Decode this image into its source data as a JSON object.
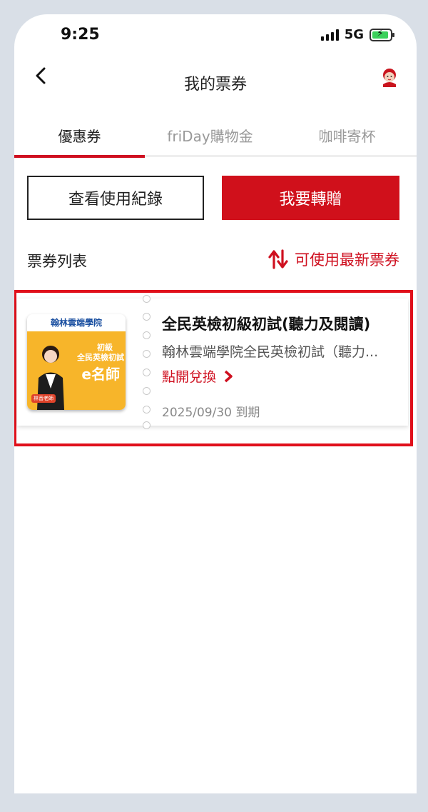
{
  "status_bar": {
    "time": "9:25",
    "network": "5G"
  },
  "header": {
    "title": "我的票券",
    "back_icon": "chevron-left-icon",
    "avatar_icon": "support-agent-icon"
  },
  "tabs": [
    {
      "label": "優惠券",
      "active": true
    },
    {
      "label": "friDay購物金",
      "active": false
    },
    {
      "label": "咖啡寄杯",
      "active": false
    }
  ],
  "actions": {
    "history_label": "查看使用紀錄",
    "gift_label": "我要轉贈"
  },
  "list": {
    "title": "票券列表",
    "sort_label": "可使用最新票券",
    "sort_icon": "sort-arrows-icon"
  },
  "ticket": {
    "title": "全民英檢初級初試(聽力及閱讀)",
    "subtitle": "翰林雲端學院全民英檢初試（聽力...",
    "redeem_label": "點開兌換",
    "expiry": "2025/09/30 到期",
    "thumb": {
      "brand": "翰林雲端學院",
      "line1": "初級",
      "line2": "全民英檢初試",
      "line3": "e名師",
      "badge": "林音老師"
    }
  },
  "colors": {
    "accent": "#d0101b",
    "background": "#d9dfe7"
  }
}
